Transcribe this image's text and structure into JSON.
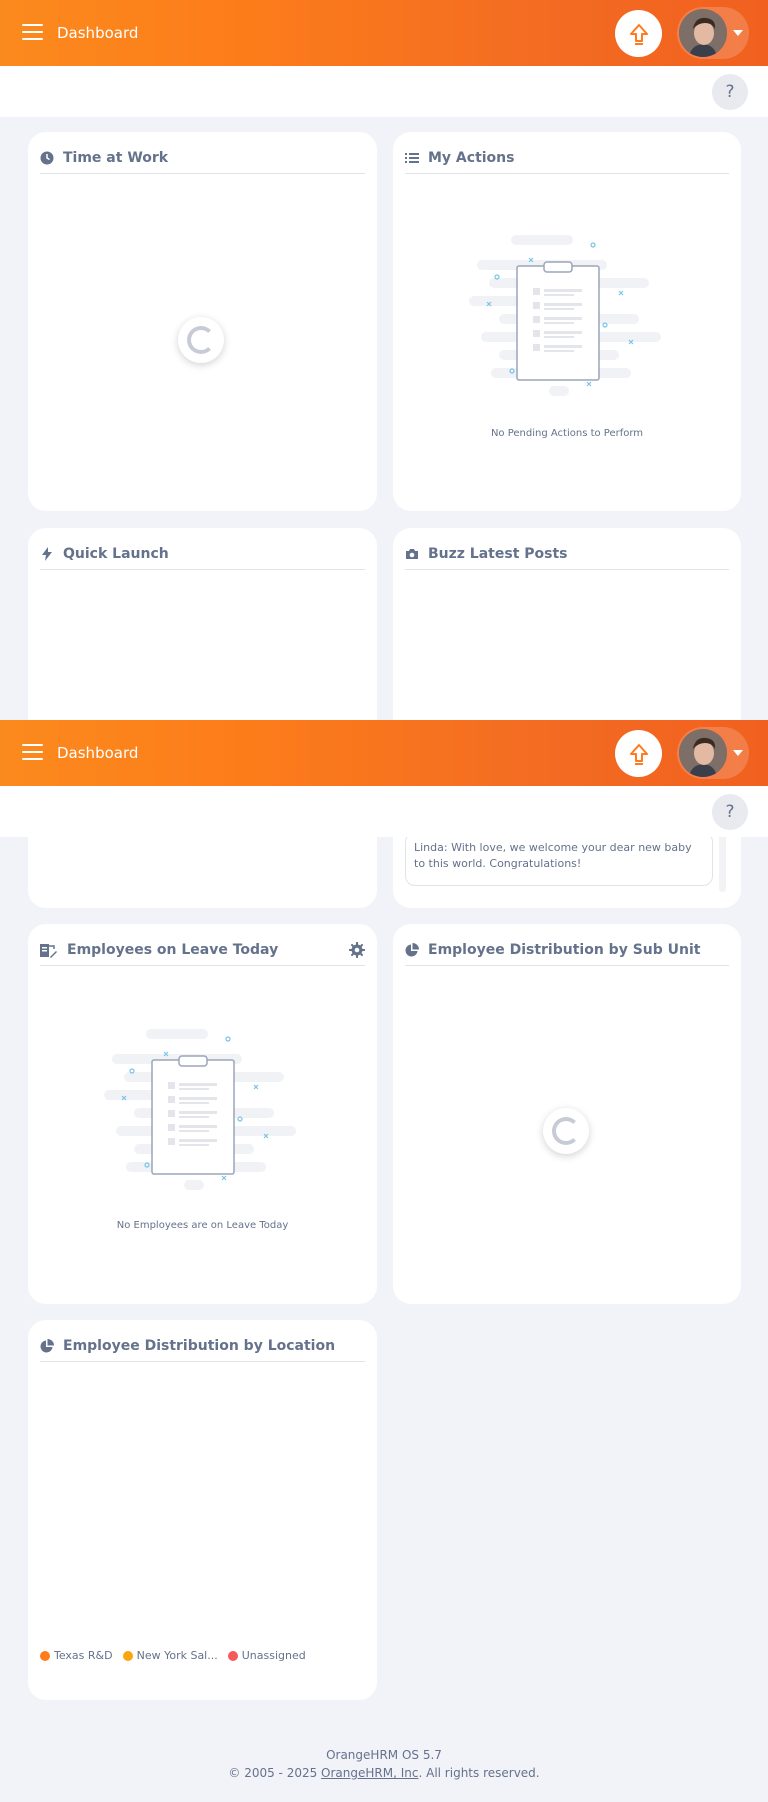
{
  "header": {
    "title": "Dashboard",
    "help_label": "?"
  },
  "widgets": {
    "time_at_work": {
      "title": "Time at Work"
    },
    "my_actions": {
      "title": "My Actions",
      "empty_text": "No Pending Actions to Perform"
    },
    "quick_launch": {
      "title": "Quick Launch"
    },
    "buzz": {
      "title": "Buzz Latest Posts",
      "post_text": "Linda: With love, we welcome your dear new baby to this world. Congratulations!"
    },
    "leave": {
      "title": "Employees on Leave Today",
      "empty_text": "No Employees are on Leave Today"
    },
    "subunit": {
      "title": "Employee Distribution by Sub Unit"
    },
    "location": {
      "title": "Employee Distribution by Location",
      "legend": [
        {
          "label": "Texas R&D",
          "color": "#ff7b1d"
        },
        {
          "label": "New York Sal...",
          "color": "#fca310"
        },
        {
          "label": "Unassigned",
          "color": "#f45a5a"
        }
      ]
    }
  },
  "colors": {
    "brand": "#ff7b1d",
    "background": "#f2f3f9"
  },
  "footer": {
    "version": "OrangeHRM OS 5.7",
    "copyright_prefix": "© 2005 - 2025 ",
    "company_link": "OrangeHRM, Inc",
    "copyright_suffix": ". All rights reserved."
  }
}
